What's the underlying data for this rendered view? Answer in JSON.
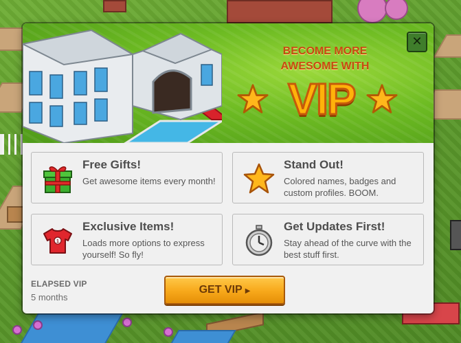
{
  "colors": {
    "accent": "#f7a81a",
    "banner_green": "#6cba22",
    "title_orange": "#c64a12",
    "close_green": "#3f7d2b"
  },
  "dialog": {
    "headline": "BECOME MORE AWESOME WITH",
    "logo": "VIP",
    "close_icon": "close-icon",
    "features": [
      {
        "icon": "gift-icon",
        "title": "Free Gifts!",
        "description": "Get awesome items every month!"
      },
      {
        "icon": "star-icon",
        "title": "Stand Out!",
        "description": "Colored names, badges and custom profiles. BOOM."
      },
      {
        "icon": "tshirt-icon",
        "title": "Exclusive Items!",
        "description": "Loads more options to express yourself! So fly!"
      },
      {
        "icon": "stopwatch-icon",
        "title": "Get Updates First!",
        "description": "Stay ahead of the curve with the best stuff first."
      }
    ],
    "elapsed_label": "ELAPSED VIP",
    "elapsed_value": "5 months",
    "cta_label": "GET VIP",
    "cta_icon": "play-arrow-icon"
  }
}
